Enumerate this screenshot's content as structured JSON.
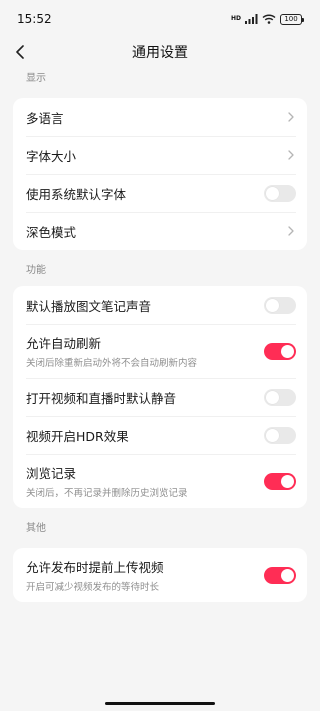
{
  "status_bar": {
    "time": "15:52",
    "network": "HD",
    "battery": "100"
  },
  "nav": {
    "title": "通用设置"
  },
  "sections": {
    "display": {
      "title": "显示",
      "items": [
        {
          "label": "多语言",
          "control": "chevron"
        },
        {
          "label": "字体大小",
          "control": "chevron"
        },
        {
          "label": "使用系统默认字体",
          "control": "toggle",
          "on": false
        },
        {
          "label": "深色模式",
          "control": "chevron"
        }
      ]
    },
    "function": {
      "title": "功能",
      "items": [
        {
          "label": "默认播放图文笔记声音",
          "control": "toggle",
          "on": false
        },
        {
          "label": "允许自动刷新",
          "desc": "关闭后除重新启动外将不会自动刷新内容",
          "control": "toggle",
          "on": true
        },
        {
          "label": "打开视频和直播时默认静音",
          "control": "toggle",
          "on": false
        },
        {
          "label": "视频开启HDR效果",
          "control": "toggle",
          "on": false
        },
        {
          "label": "浏览记录",
          "desc": "关闭后，不再记录并删除历史浏览记录",
          "control": "toggle",
          "on": true
        }
      ]
    },
    "other": {
      "title": "其他",
      "items": [
        {
          "label": "允许发布时提前上传视频",
          "desc": "开启可减少视频发布的等待时长",
          "control": "toggle",
          "on": true
        }
      ]
    }
  },
  "colors": {
    "accent": "#ff2d55",
    "toggle_off": "#e9e9e9",
    "background": "#f5f5f5"
  },
  "icons": {
    "back": "chevron-left-icon",
    "row_arrow": "chevron-right-icon"
  }
}
